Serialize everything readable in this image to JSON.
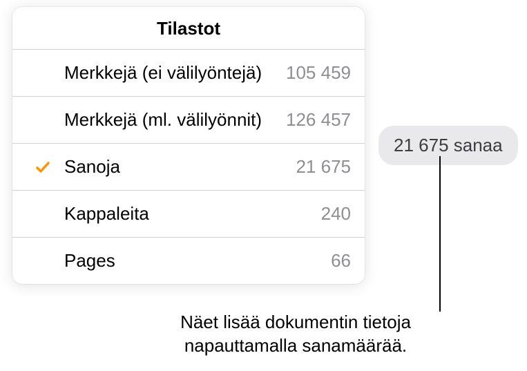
{
  "panel": {
    "title": "Tilastot",
    "rows": [
      {
        "label": "Merkkejä (ei välilyöntejä)",
        "value": "105 459",
        "selected": false
      },
      {
        "label": "Merkkejä (ml. välilyönnit)",
        "value": "126 457",
        "selected": false
      },
      {
        "label": "Sanoja",
        "value": "21 675",
        "selected": true
      },
      {
        "label": "Kappaleita",
        "value": "240",
        "selected": false
      },
      {
        "label": "Pages",
        "value": "66",
        "selected": false
      }
    ]
  },
  "summary": "21 675 sanaa",
  "caption": "Näet lisää dokumentin tietoja napauttamalla sanamäärää.",
  "colors": {
    "accent": "#ff9500",
    "secondary_text": "#8e8e93"
  }
}
